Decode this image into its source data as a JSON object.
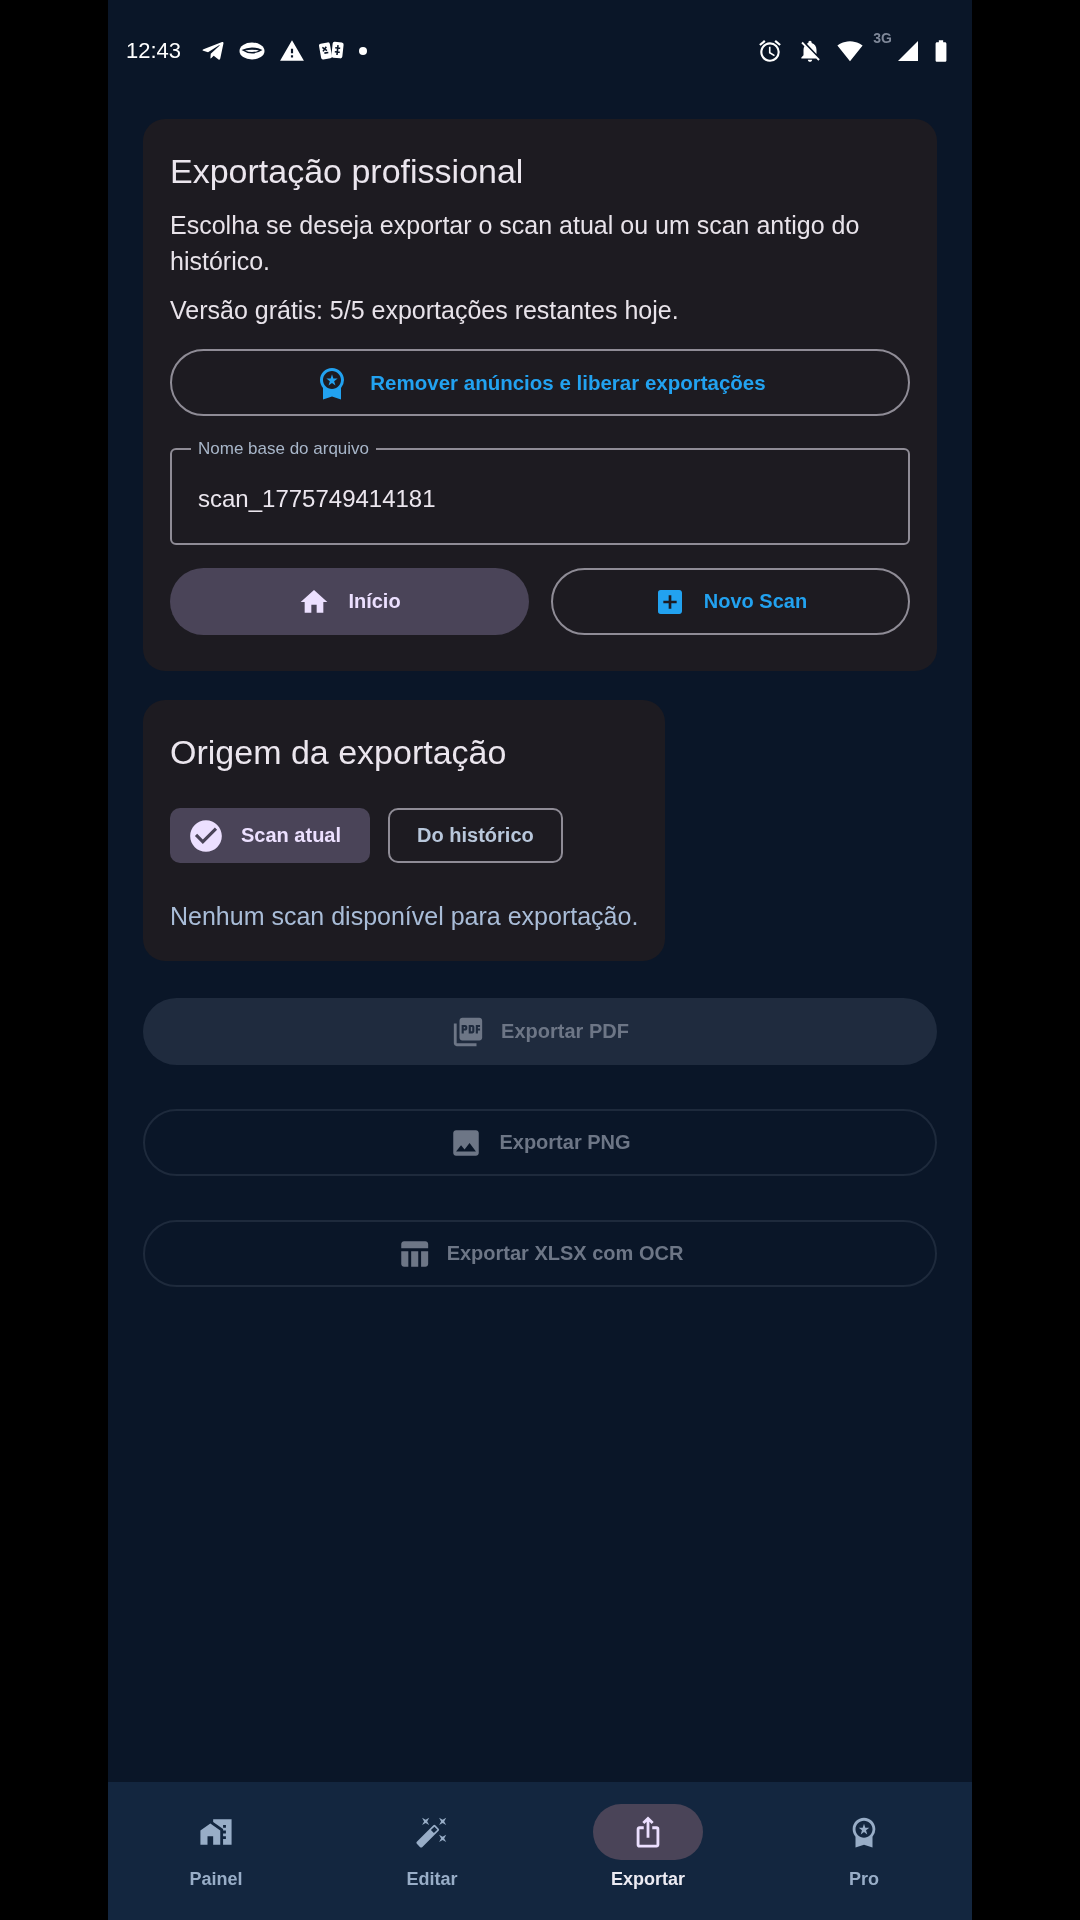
{
  "status_bar": {
    "time": "12:43",
    "network": "3G"
  },
  "export_card": {
    "title": "Exportação profissional",
    "description": "Escolha se deseja exportar o scan atual ou um scan antigo do histórico.",
    "quota": "Versão grátis: 5/5 exportações restantes hoje.",
    "upgrade_button": "Remover anúncios e liberar exportações",
    "filename_field": {
      "label": "Nome base do arquivo",
      "value": "scan_1775749414181"
    },
    "actions": [
      {
        "label": "Início",
        "kind": "tonal"
      },
      {
        "label": "Novo Scan",
        "kind": "outlined"
      }
    ]
  },
  "source_card": {
    "title": "Origem da exportação",
    "options": [
      {
        "label": "Scan atual",
        "selected": true
      },
      {
        "label": "Do histórico",
        "selected": false
      }
    ],
    "message": "Nenhum scan disponível para exportação."
  },
  "export_buttons": [
    {
      "label": "Exportar PDF",
      "kind": "filled",
      "disabled": true
    },
    {
      "label": "Exportar PNG",
      "kind": "outlined",
      "disabled": true
    },
    {
      "label": "Exportar XLSX com OCR",
      "kind": "outlined",
      "disabled": true
    }
  ],
  "bottom_nav": [
    {
      "label": "Painel",
      "selected": false
    },
    {
      "label": "Editar",
      "selected": false
    },
    {
      "label": "Exportar",
      "selected": true
    },
    {
      "label": "Pro",
      "selected": false
    }
  ]
}
